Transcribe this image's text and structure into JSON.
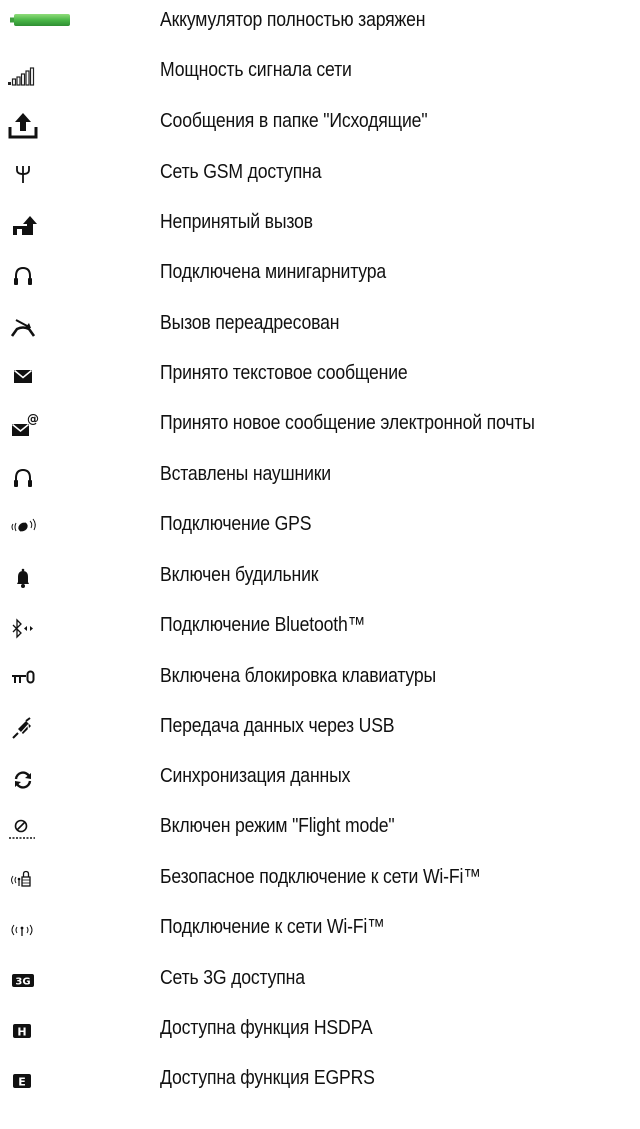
{
  "icons": [
    {
      "icon": "battery-full-icon",
      "label": "Аккумулятор полностью заряжен",
      "color": "#4bb748"
    },
    {
      "icon": "signal-strength-icon",
      "label": "Мощность сигнала сети"
    },
    {
      "icon": "outbox-icon",
      "label": "Сообщения в папке \"Исходящие\""
    },
    {
      "icon": "gsm-antenna-icon",
      "label": "Сеть GSM доступна"
    },
    {
      "icon": "missed-call-icon",
      "label": "Непринятый вызов"
    },
    {
      "icon": "handsfree-icon",
      "label": "Подключена минигарнитура"
    },
    {
      "icon": "call-forward-icon",
      "label": "Вызов переадресован"
    },
    {
      "icon": "text-message-icon",
      "label": "Принято текстовое сообщение"
    },
    {
      "icon": "email-message-icon",
      "label": "Принято новое сообщение электронной почты"
    },
    {
      "icon": "headphones-icon",
      "label": "Вставлены наушники"
    },
    {
      "icon": "gps-icon",
      "label": "Подключение GPS"
    },
    {
      "icon": "alarm-bell-icon",
      "label": "Включен будильник"
    },
    {
      "icon": "bluetooth-icon",
      "label": "Подключение Bluetooth™"
    },
    {
      "icon": "keylock-icon",
      "label": "Включена блокировка клавиатуры"
    },
    {
      "icon": "usb-transfer-icon",
      "label": "Передача данных через USB"
    },
    {
      "icon": "sync-icon",
      "label": "Синхронизация данных"
    },
    {
      "icon": "flight-mode-icon",
      "label": "Включен режим \"Flight mode\""
    },
    {
      "icon": "wifi-secure-icon",
      "label": "Безопасное подключение к сети Wi-Fi™"
    },
    {
      "icon": "wifi-icon",
      "label": "Подключение к сети Wi-Fi™"
    },
    {
      "icon": "3g-network-icon",
      "label": "Сеть 3G доступна",
      "glyph": "3G"
    },
    {
      "icon": "hsdpa-icon",
      "label": "Доступна функция HSDPA",
      "glyph": "H"
    },
    {
      "icon": "egprs-icon",
      "label": "Доступна функция EGPRS",
      "glyph": "E"
    }
  ]
}
